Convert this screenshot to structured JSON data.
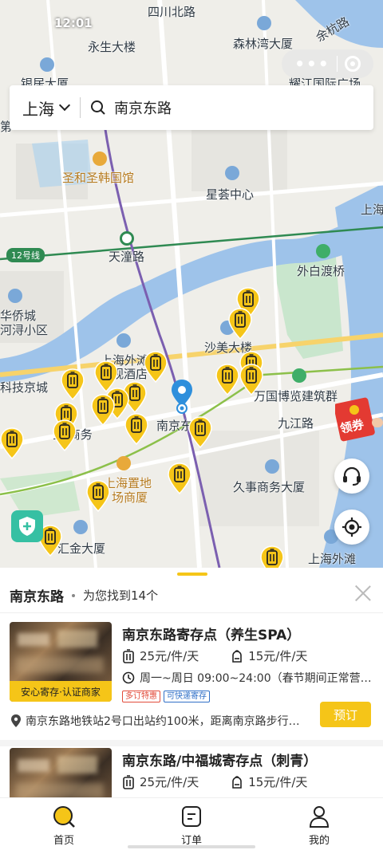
{
  "status_bar": {
    "time": "12:01"
  },
  "search": {
    "city": "上海",
    "query": "南京东路"
  },
  "map": {
    "labels": {
      "sichuan_north_road": "四川北路",
      "yongsheng_tower": "永生大楼",
      "senlin_bay": "森林湾大厦",
      "yuhang_road": "余杭路",
      "yinju_tower": "银居大厦",
      "yaojiang": "耀江国际广场",
      "shenghe_korean": "圣和圣韩国馆",
      "xinghui": "星荟中心",
      "shanghai_yue": "上海悦",
      "line12": "12号线",
      "tiantong_road": "天潼路",
      "waibaidu_bridge": "外白渡桥",
      "huaqiao_city": "华侨城",
      "hechun_community": "河浔小区",
      "shamei_tower": "沙美大楼",
      "bund_hotel": "上海外滩",
      "guanzhi_hotel": "观酒店",
      "tech_city": "科技京城",
      "wanguo": "万国博览建筑群",
      "jiujiang_road": "九江路",
      "nanjing_east": "南京东",
      "shanghai_zhidi": "上海置地",
      "shanghai_zhidi2": "场商厦",
      "jiushi_tower": "久事商务大厦",
      "huijin_tower": "汇金大厦",
      "shanghai_waitan": "上海外滩",
      "jinmao_business": "金   商务",
      "di": "第"
    },
    "coupon_label": "领券"
  },
  "results": {
    "place": "南京东路",
    "count_text": "为您找到14个"
  },
  "cards": [
    {
      "title": "南京东路寄存点（养生SPA）",
      "badge": "安心寄存·认证商家",
      "price_large": "25元/件/天",
      "price_small": "15元/件/天",
      "hours": "周一~周日 09:00~24:00（春节期间正常营…",
      "tags": [
        "多订特惠",
        "可快递寄存"
      ],
      "address": "南京东路地铁站2号口出站约100米，距离南京路步行…",
      "book_label": "预订"
    },
    {
      "title": "南京东路/中福城寄存点（刺青）",
      "price_large": "25元/件/天",
      "price_small": "15元/件/天"
    }
  ],
  "tabbar": [
    {
      "label": "首页",
      "icon": "home-search-icon",
      "active": true
    },
    {
      "label": "订单",
      "icon": "order-icon",
      "active": false
    },
    {
      "label": "我的",
      "icon": "profile-icon",
      "active": false
    }
  ],
  "colors": {
    "accent": "#f5c518",
    "road_purple": "#7b5fb0",
    "water": "#9ec3ea",
    "safe_green": "#36c0a3"
  }
}
